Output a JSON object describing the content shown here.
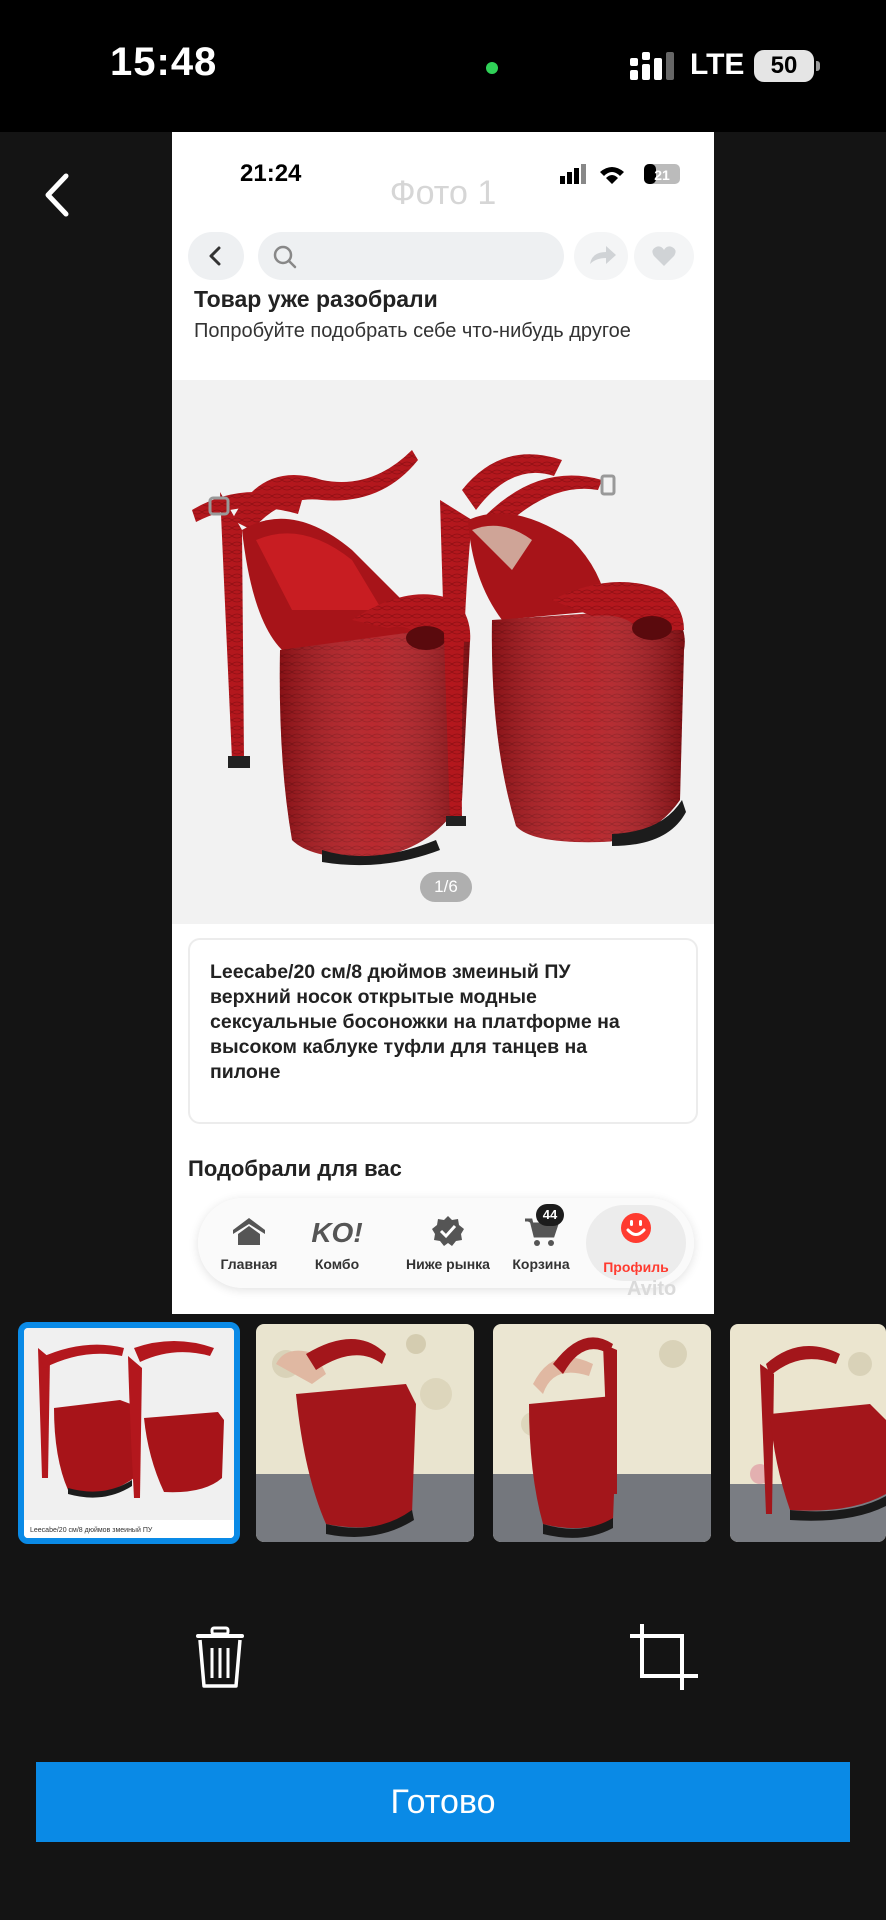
{
  "status_bar": {
    "time": "15:48",
    "network": "LTE",
    "battery": "50"
  },
  "inner": {
    "status_time": "21:24",
    "battery": "21",
    "header_title": "Фото 1",
    "sold_title": "Товар уже разобрали",
    "sold_subtitle": "Попробуйте подобрать себе что-нибудь другое",
    "photo_counter": "1/6",
    "description": "Leecabe/20 см/8 дюймов змеиный ПУ верхний носок открытые модные сексуальные босоножки на платформе на высоком каблуке туфли для танцев на пилоне",
    "recommend_title": "Подобрали для вас",
    "tabs": [
      {
        "label": "Главная",
        "icon": "home-icon"
      },
      {
        "label": "Комбо",
        "icon": "ko-logo-icon"
      },
      {
        "label": "Ниже рынка",
        "icon": "check-badge-icon"
      },
      {
        "label": "Корзина",
        "icon": "cart-icon"
      },
      {
        "label": "Профиль",
        "icon": "smile-icon"
      }
    ],
    "cart_badge": "44",
    "watermark": "Avito"
  },
  "thumbnails": [
    {
      "caption": "Leecabe/20 см/8 дюймов змеиный ПУ",
      "selected": true
    },
    {
      "selected": false
    },
    {
      "selected": false
    },
    {
      "selected": false
    }
  ],
  "actions": {
    "done_label": "Готово"
  },
  "colors": {
    "accent": "#0a8ae6",
    "shoe": "#b3171d",
    "profile": "#ff3b30"
  }
}
